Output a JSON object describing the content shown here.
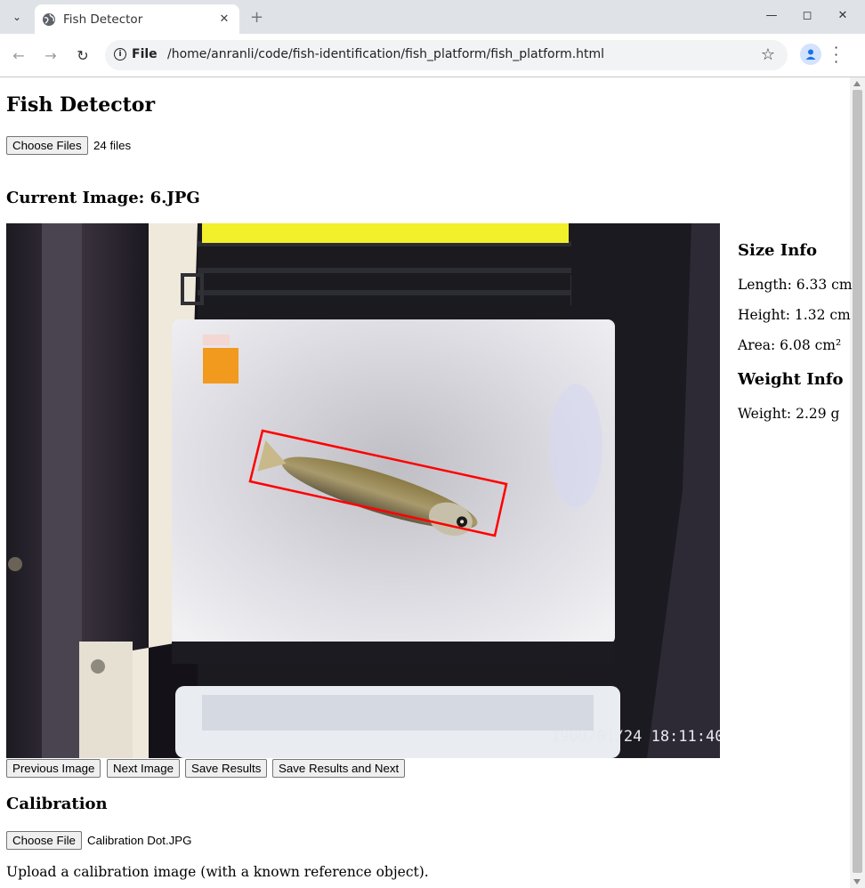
{
  "browser": {
    "tab_title": "Fish Detector",
    "url_scheme": "File",
    "url": "/home/anranli/code/fish-identification/fish_platform/fish_platform.html"
  },
  "page": {
    "title": "Fish Detector",
    "choose_files_label": "Choose Files",
    "files_status": "24 files",
    "current_image_heading": "Current Image: 6.JPG",
    "image_timestamp": "1900/01/24 18:11:40",
    "size_info": {
      "heading": "Size Info",
      "length": "Length: 6.33 cm",
      "height": "Height: 1.32 cm",
      "area": "Area: 6.08 cm²"
    },
    "weight_info": {
      "heading": "Weight Info",
      "weight": "Weight: 2.29 g"
    },
    "buttons": {
      "previous": "Previous Image",
      "next": "Next Image",
      "save": "Save Results",
      "save_next": "Save Results and Next"
    },
    "calibration": {
      "heading": "Calibration",
      "choose_file_label": "Choose File",
      "file_name": "Calibration Dot.JPG",
      "note": "Upload a calibration image (with a known reference object)."
    }
  }
}
